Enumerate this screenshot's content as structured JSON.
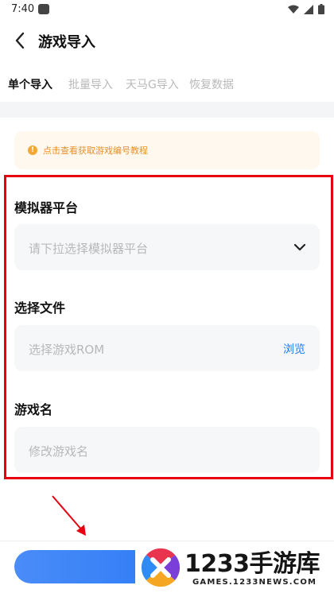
{
  "status_bar": {
    "time": "7:40",
    "icons": [
      "app-notification-icon",
      "wifi-icon",
      "signal-icon",
      "battery-icon"
    ]
  },
  "header": {
    "title": "游戏导入",
    "back_icon": "back-arrow-icon"
  },
  "tabs": [
    {
      "label": "单个导入",
      "active": true
    },
    {
      "label": "批量导入",
      "active": false
    },
    {
      "label": "天马G导入",
      "active": false
    },
    {
      "label": "恢复数据",
      "active": false
    }
  ],
  "notice": {
    "icon": "info-icon",
    "text": "点击查看获取游戏编号教程"
  },
  "form": {
    "platform": {
      "label": "模拟器平台",
      "placeholder": "请下拉选择模拟器平台",
      "icon": "chevron-down-icon"
    },
    "file": {
      "label": "选择文件",
      "placeholder": "选择游戏ROM",
      "browse_label": "浏览"
    },
    "name": {
      "label": "游戏名",
      "placeholder": "修改游戏名"
    }
  },
  "watermark": {
    "title": "1233手游库",
    "url": "GAMES.1233NEWS.COM"
  },
  "colors": {
    "accent_blue": "#1a7af8",
    "highlight_red": "#e60012",
    "notice_orange": "#e8912a",
    "button_blue": "#3b82f6"
  }
}
